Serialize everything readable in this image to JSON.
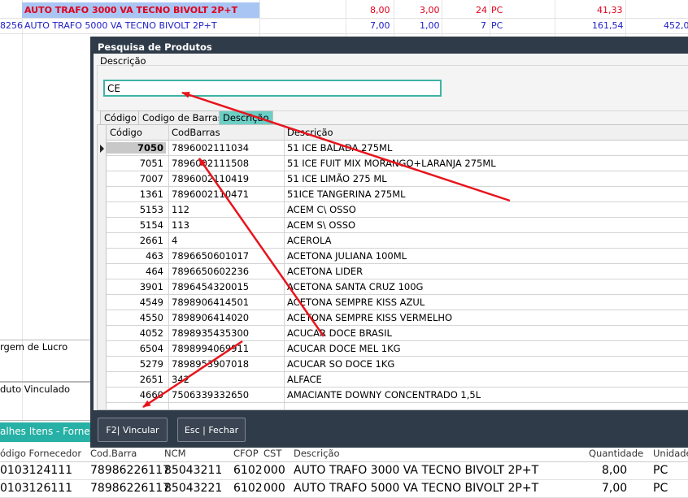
{
  "background_table": {
    "rows": [
      {
        "code": "",
        "desc": "AUTO TRAFO 3000 VA TECNO BIVOLT 2P+T",
        "v1": "8,00",
        "v2": "3,00",
        "v3": "24",
        "unit": "PC",
        "v4": "41,33",
        "v5": ""
      },
      {
        "code": "8256",
        "desc": "AUTO TRAFO 5000 VA TECNO BIVOLT 2P+T",
        "v1": "7,00",
        "v2": "1,00",
        "v3": "7",
        "unit": "PC",
        "v4": "161,54",
        "v5": "452,0"
      }
    ]
  },
  "side": {
    "margem_label": "rgem de Lucro",
    "produto_label": "duto Vinculado",
    "details_tab": "alhes Itens - Fornece"
  },
  "bottom_table": {
    "headers": {
      "cod_fornecedor": "ódigo Fornecedor",
      "cod_barra": "Cod.Barra",
      "ncm": "NCM",
      "cfop": "CFOP",
      "cst": "CST",
      "descricao": "Descrição",
      "quantidade": "Quantidade",
      "unidade": "Unidade"
    },
    "rows": [
      {
        "cod_fornecedor": "0103124111",
        "cod_barra": "78986226117",
        "ncm": "85043211",
        "cfop": "6102",
        "cst": "000",
        "descricao": "AUTO TRAFO 3000 VA TECNO BIVOLT 2P+T",
        "quantidade": "8,00",
        "unidade": "PC"
      },
      {
        "cod_fornecedor": "0103126111",
        "cod_barra": "78986226117",
        "ncm": "85043221",
        "cfop": "6102",
        "cst": "000",
        "descricao": "AUTO TRAFO 5000 VA TECNO BIVOLT 2P+T",
        "quantidade": "7,00",
        "unidade": "PC"
      }
    ]
  },
  "dialog": {
    "title": "Pesquisa de Produtos",
    "search_label": "Descrição",
    "search_value": "CE",
    "tabs": [
      "Código",
      "Codigo de Barras",
      "Descrição"
    ],
    "active_tab": "Descrição",
    "grid": {
      "headers": {
        "codigo": "Código",
        "codbarras": "CodBarras",
        "descricao": "Descrição"
      },
      "rows": [
        {
          "codigo": "7050",
          "codbarras": "7896002111034",
          "descricao": "51 ICE BALADA 275ML"
        },
        {
          "codigo": "7051",
          "codbarras": "7896002111508",
          "descricao": "51 ICE FUIT MIX MORANGO+LARANJA 275ML"
        },
        {
          "codigo": "7007",
          "codbarras": "7896002110419",
          "descricao": "51 ICE LIMÃO 275 ML"
        },
        {
          "codigo": "1361",
          "codbarras": "7896002110471",
          "descricao": "51ICE TANGERINA 275ML"
        },
        {
          "codigo": "5153",
          "codbarras": "112",
          "descricao": "ACEM C\\ OSSO"
        },
        {
          "codigo": "5154",
          "codbarras": "113",
          "descricao": "ACEM S\\ OSSO"
        },
        {
          "codigo": "2661",
          "codbarras": "4",
          "descricao": "ACEROLA"
        },
        {
          "codigo": "463",
          "codbarras": "7896650601017",
          "descricao": "ACETONA JULIANA 100ML"
        },
        {
          "codigo": "464",
          "codbarras": "7896650602236",
          "descricao": "ACETONA LIDER"
        },
        {
          "codigo": "3901",
          "codbarras": "7896454320015",
          "descricao": "ACETONA SANTA CRUZ 100G"
        },
        {
          "codigo": "4549",
          "codbarras": "7898906414501",
          "descricao": "ACETONA SEMPRE KISS AZUL"
        },
        {
          "codigo": "4550",
          "codbarras": "7898906414020",
          "descricao": "ACETONA SEMPRE KISS VERMELHO"
        },
        {
          "codigo": "4052",
          "codbarras": "7898935435300",
          "descricao": "ACUCAR DOCE BRASIL"
        },
        {
          "codigo": "6504",
          "codbarras": "7898994069911",
          "descricao": "ACUCAR DOCE MEL 1KG"
        },
        {
          "codigo": "5279",
          "codbarras": "7898953907018",
          "descricao": "ACUCAR SO DOCE 1KG"
        },
        {
          "codigo": "2651",
          "codbarras": "342",
          "descricao": "ALFACE"
        },
        {
          "codigo": "4660",
          "codbarras": "7506339332650",
          "descricao": "AMACIANTE DOWNY CONCENTRADO 1,5L"
        }
      ]
    },
    "buttons": {
      "vincular": "F2| Vincular",
      "fechar": "Esc | Fechar"
    }
  },
  "colors": {
    "accent_teal": "#3fb4a5",
    "dialog_dark": "#2f3b49",
    "arrow_red": "#e8141c",
    "row_red": "#e0001b",
    "row_blue": "#1c1cc8"
  }
}
